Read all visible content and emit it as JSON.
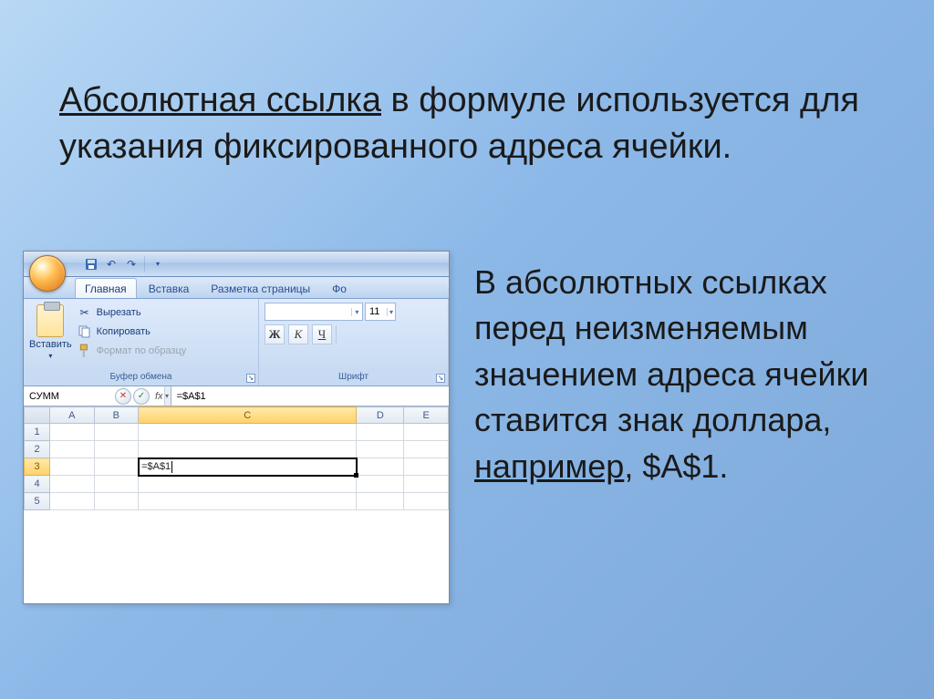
{
  "heading": {
    "part1": "Абсолютная ссылка",
    "part2": " в формуле используется для указания фиксированного адреса ячейки."
  },
  "sidetext": {
    "part1": "В абсолютных ссылках перед неизменяемым значением адреса ячейки ставится знак доллара, ",
    "part2": "например",
    "part3": ", $A$1."
  },
  "excel": {
    "tabs": {
      "home": "Главная",
      "insert": "Вставка",
      "layout": "Разметка страницы",
      "formulas": "Фо"
    },
    "clipboard": {
      "paste": "Вставить",
      "cut": "Вырезать",
      "copy": "Копировать",
      "format": "Формат по образцу",
      "group": "Буфер обмена"
    },
    "font": {
      "group": "Шрифт",
      "size": "11",
      "bold": "Ж",
      "italic": "К",
      "underline": "Ч"
    },
    "namebox": "СУММ",
    "fx": "fx",
    "formula": "=$A$1",
    "cols": [
      "A",
      "B",
      "C",
      "D",
      "E"
    ],
    "rows": [
      "1",
      "2",
      "3",
      "4",
      "5"
    ],
    "cellvalue": "=$A$1"
  }
}
